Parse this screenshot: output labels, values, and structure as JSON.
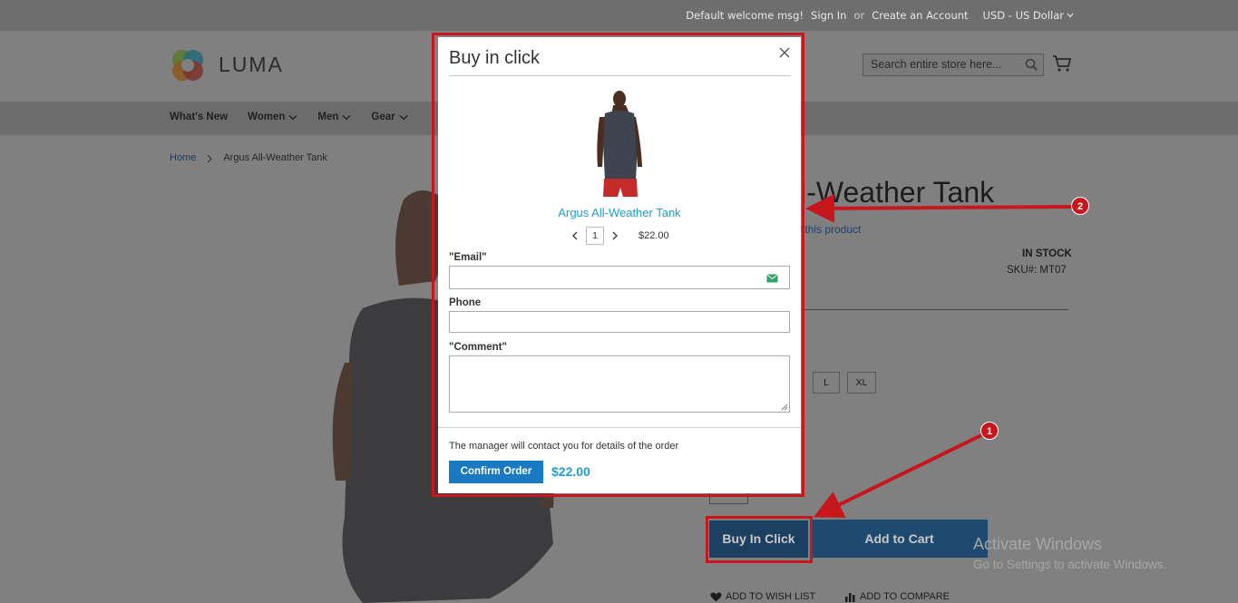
{
  "topbar": {
    "welcome": "Default welcome msg!",
    "sign_in": "Sign In",
    "or": "or",
    "create_account": "Create an Account",
    "currency": "USD - US Dollar"
  },
  "header": {
    "logo_text": "LUMA",
    "search_placeholder": "Search entire store here..."
  },
  "nav": {
    "items": [
      {
        "label": "What's New",
        "has_dropdown": false
      },
      {
        "label": "Women",
        "has_dropdown": true
      },
      {
        "label": "Men",
        "has_dropdown": true
      },
      {
        "label": "Gear",
        "has_dropdown": true
      }
    ]
  },
  "breadcrumb": {
    "home": "Home",
    "current": "Argus All-Weather Tank"
  },
  "product": {
    "title_visible": "ll-Weather Tank",
    "review_link_visible": "y this product",
    "stock": "IN STOCK",
    "sku": "SKU#:  MT07",
    "sizes_visible": [
      "L",
      "XL"
    ],
    "buy_in_click_label": "Buy In Click",
    "add_to_cart_label": "Add to Cart",
    "wishlist_label": "ADD TO WISH LIST",
    "compare_label": "ADD TO COMPARE"
  },
  "modal": {
    "title": "Buy in click",
    "product_name": "Argus All-Weather Tank",
    "qty": "1",
    "unit_price": "$22.00",
    "email_label": "\"Email\"",
    "email_value": "",
    "phone_label": "Phone",
    "phone_value": "",
    "comment_label": "\"Comment\"",
    "comment_value": "",
    "footer_note": "The manager will contact you for details of the order",
    "confirm_label": "Confirm Order",
    "total": "$22.00"
  },
  "annotations": {
    "badge_1": "1",
    "badge_2": "2",
    "color": "#c8161d"
  },
  "os_watermark": {
    "line1": "Activate Windows",
    "line2": "Go to Settings to activate Windows."
  },
  "colors": {
    "overlay_dark": "#808080",
    "link_blue": "#1e9fcb",
    "button_blue": "#1979c3",
    "highlight_red": "#c8161d"
  }
}
